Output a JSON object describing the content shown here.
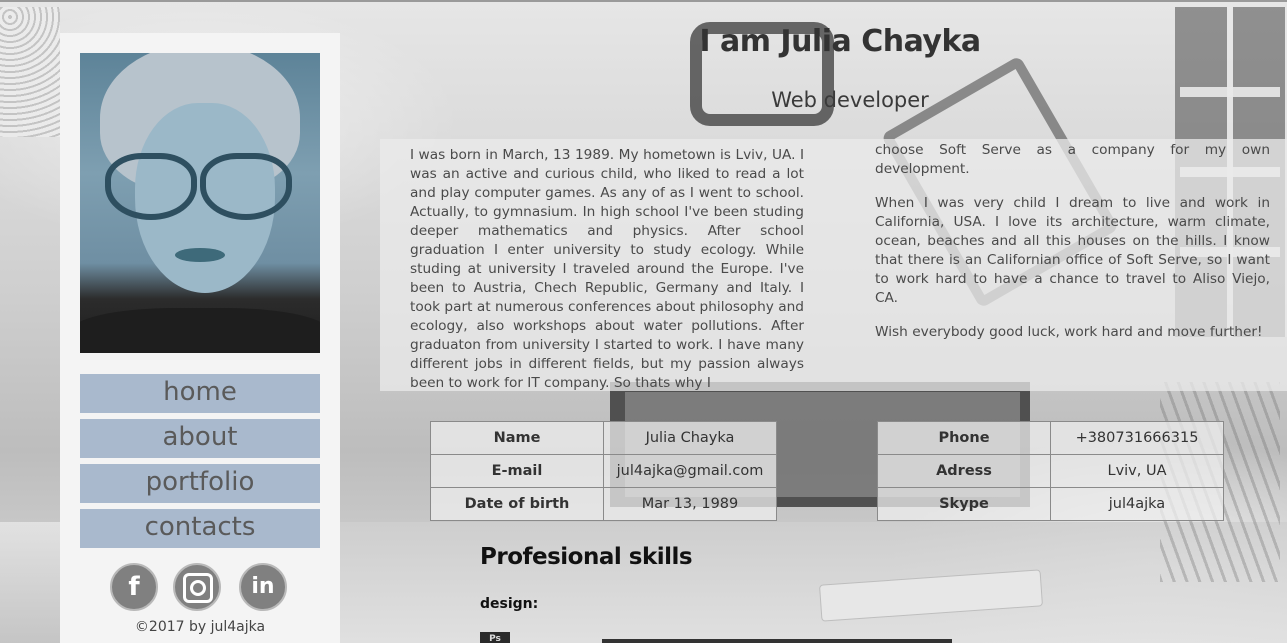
{
  "header": {
    "title": "I am Julia Chayka",
    "subtitle": "Web developer"
  },
  "sidebar": {
    "nav": [
      {
        "label": "home"
      },
      {
        "label": "about"
      },
      {
        "label": "portfolio"
      },
      {
        "label": "contacts"
      }
    ],
    "social": [
      {
        "name": "facebook-icon",
        "glyph": "f"
      },
      {
        "name": "instagram-icon",
        "glyph": ""
      },
      {
        "name": "linkedin-icon",
        "glyph": "in"
      }
    ],
    "copyright": "©2017 by jul4ajka"
  },
  "bio": {
    "left": "I was born in March, 13 1989. My hometown is Lviv, UA. I was an active and curious child, who liked to read a lot and play computer games. As any of as I went to school. Actually, to gymnasium. In high school I've been studing deeper mathematics and physics. After school graduation I enter university to study ecology. While studing at university I traveled around the Europe. I've been to Austria, Chech Republic, Germany and Italy. I took part at numerous conferences about philosophy and ecology, also workshops about water pollutions. After graduaton from university I started to work. I have many different jobs in different fields, but my passion always been to work for IT company. So thats why I",
    "right_p1": "choose Soft Serve as a company for my own development.",
    "right_p2": "When I was very child I dream to live and work in California, USA. I love its architecture, warm climate, ocean, beaches and all this houses on the hills. I know that there is an Californian office of Soft Serve, so I want to work hard to have a chance to travel to Aliso Viejo, CA.",
    "right_p3": "Wish everybody good luck, work hard and move further!"
  },
  "info_left": [
    {
      "key": "Name",
      "value": "Julia Chayka"
    },
    {
      "key": "E-mail",
      "value": "jul4ajka@gmail.com"
    },
    {
      "key": "Date of birth",
      "value": "Mar 13, 1989"
    }
  ],
  "info_right": [
    {
      "key": "Phone",
      "value": "+380731666315"
    },
    {
      "key": "Adress",
      "value": "Lviv, UA"
    },
    {
      "key": "Skype",
      "value": "jul4ajka"
    }
  ],
  "skills": {
    "title": "Profesional skills",
    "category": "design:",
    "first_skill_icon": "Ps"
  },
  "colors": {
    "nav_bg": "#a9b9cd",
    "nav_text": "#5a5a5a",
    "sidebar_bg": "#f4f4f4",
    "social_icon_bg": "#808080"
  }
}
